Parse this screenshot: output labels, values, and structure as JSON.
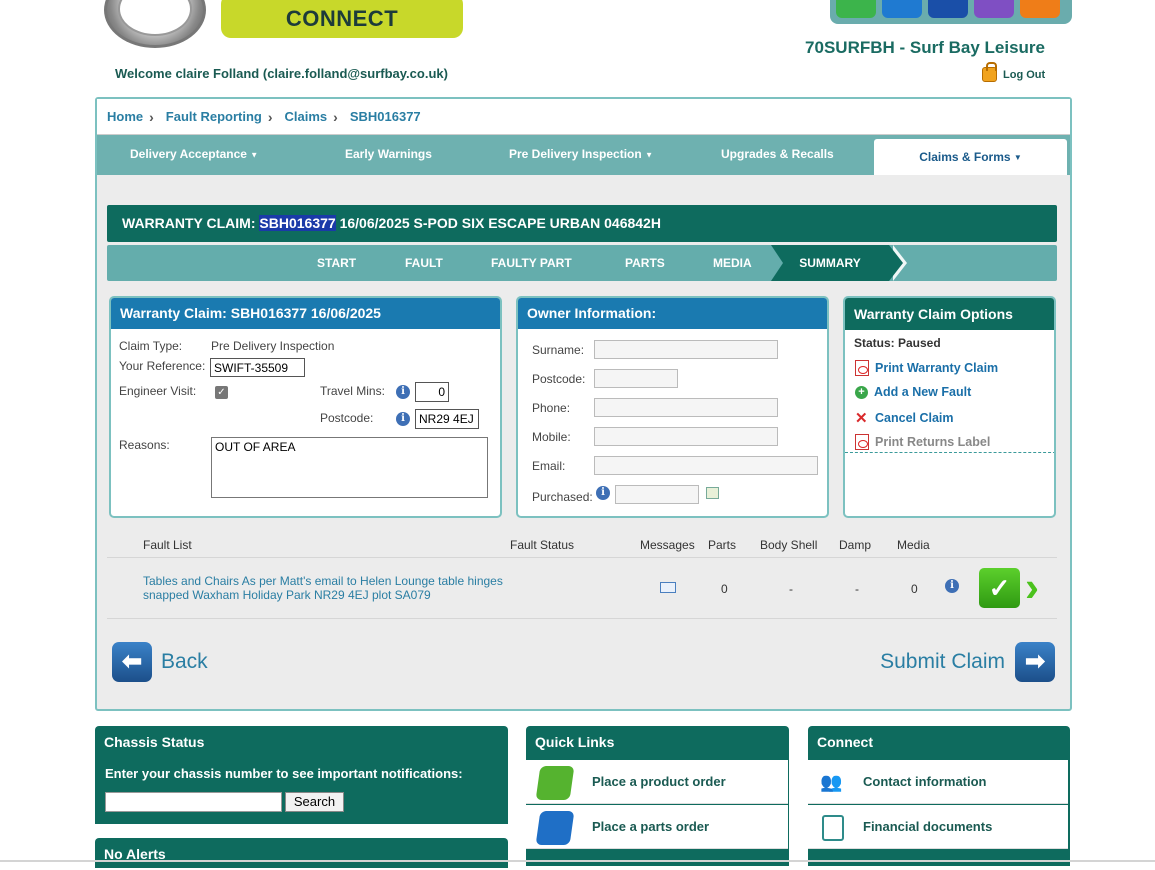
{
  "header": {
    "brand_pill": "CONNECT",
    "dealer_name": "70SURFBH - Surf Bay Leisure",
    "welcome": "Welcome claire Folland (claire.folland@surfbay.co.uk)",
    "logout": "Log Out",
    "tray_icon_colors": [
      "#3cb44b",
      "#1f7ad1",
      "#1a4fa8",
      "#7f4fc3",
      "#ef7d18"
    ]
  },
  "breadcrumb": [
    "Home",
    "Fault Reporting",
    "Claims",
    "SBH016377"
  ],
  "nav": {
    "items": [
      {
        "label": "Delivery Acceptance",
        "dropdown": true
      },
      {
        "label": "Early Warnings",
        "dropdown": false
      },
      {
        "label": "Pre Delivery Inspection",
        "dropdown": true
      },
      {
        "label": "Upgrades & Recalls",
        "dropdown": false
      }
    ],
    "active": "Claims & Forms"
  },
  "claim": {
    "title_prefix": "WARRANTY CLAIM:",
    "title_id": "SBH016377",
    "title_rest": "16/06/2025 S-POD SIX ESCAPE URBAN 046842H"
  },
  "steps": [
    "START",
    "FAULT",
    "FAULTY PART",
    "PARTS",
    "MEDIA"
  ],
  "active_step": "SUMMARY",
  "warranty_panel": {
    "title": "Warranty Claim: SBH016377 16/06/2025",
    "claim_type_label": "Claim Type:",
    "claim_type": "Pre Delivery Inspection",
    "reference_label": "Your Reference:",
    "reference": "SWIFT-35509",
    "engineer_label": "Engineer Visit:",
    "engineer_checked": true,
    "travel_label": "Travel Mins:",
    "travel_mins": "0",
    "postcode_label": "Postcode:",
    "postcode": "NR29 4EJ",
    "reasons_label": "Reasons:",
    "reasons": "OUT OF AREA"
  },
  "owner_panel": {
    "title": "Owner Information:",
    "fields": [
      "Surname:",
      "Postcode:",
      "Phone:",
      "Mobile:",
      "Email:"
    ],
    "purchased_label": "Purchased:"
  },
  "options_panel": {
    "title": "Warranty Claim Options",
    "status": "Status: Paused",
    "print_claim": "Print Warranty Claim",
    "add_fault": "Add a New Fault",
    "cancel_claim": "Cancel Claim",
    "print_returns": "Print Returns Label"
  },
  "fault_table": {
    "headers": [
      "Fault List",
      "Fault Status",
      "Messages",
      "Parts",
      "Body Shell",
      "Damp",
      "Media"
    ],
    "row": {
      "description": "Tables and Chairs As per Matt's email to Helen Lounge table hinges snapped Waxham Holiday Park NR29 4EJ plot SA079",
      "status": "",
      "parts": "0",
      "body_shell": "-",
      "damp": "-",
      "media": "0"
    }
  },
  "actions": {
    "back": "Back",
    "submit": "Submit Claim"
  },
  "chassis": {
    "title": "Chassis Status",
    "prompt": "Enter your chassis number to see important notifications:",
    "search_btn": "Search",
    "alerts_title": "No Alerts"
  },
  "quick_links": {
    "title": "Quick Links",
    "items": [
      "Place a product order",
      "Place a parts order"
    ]
  },
  "connect_panel": {
    "title": "Connect",
    "items": [
      "Contact information",
      "Financial documents"
    ]
  }
}
